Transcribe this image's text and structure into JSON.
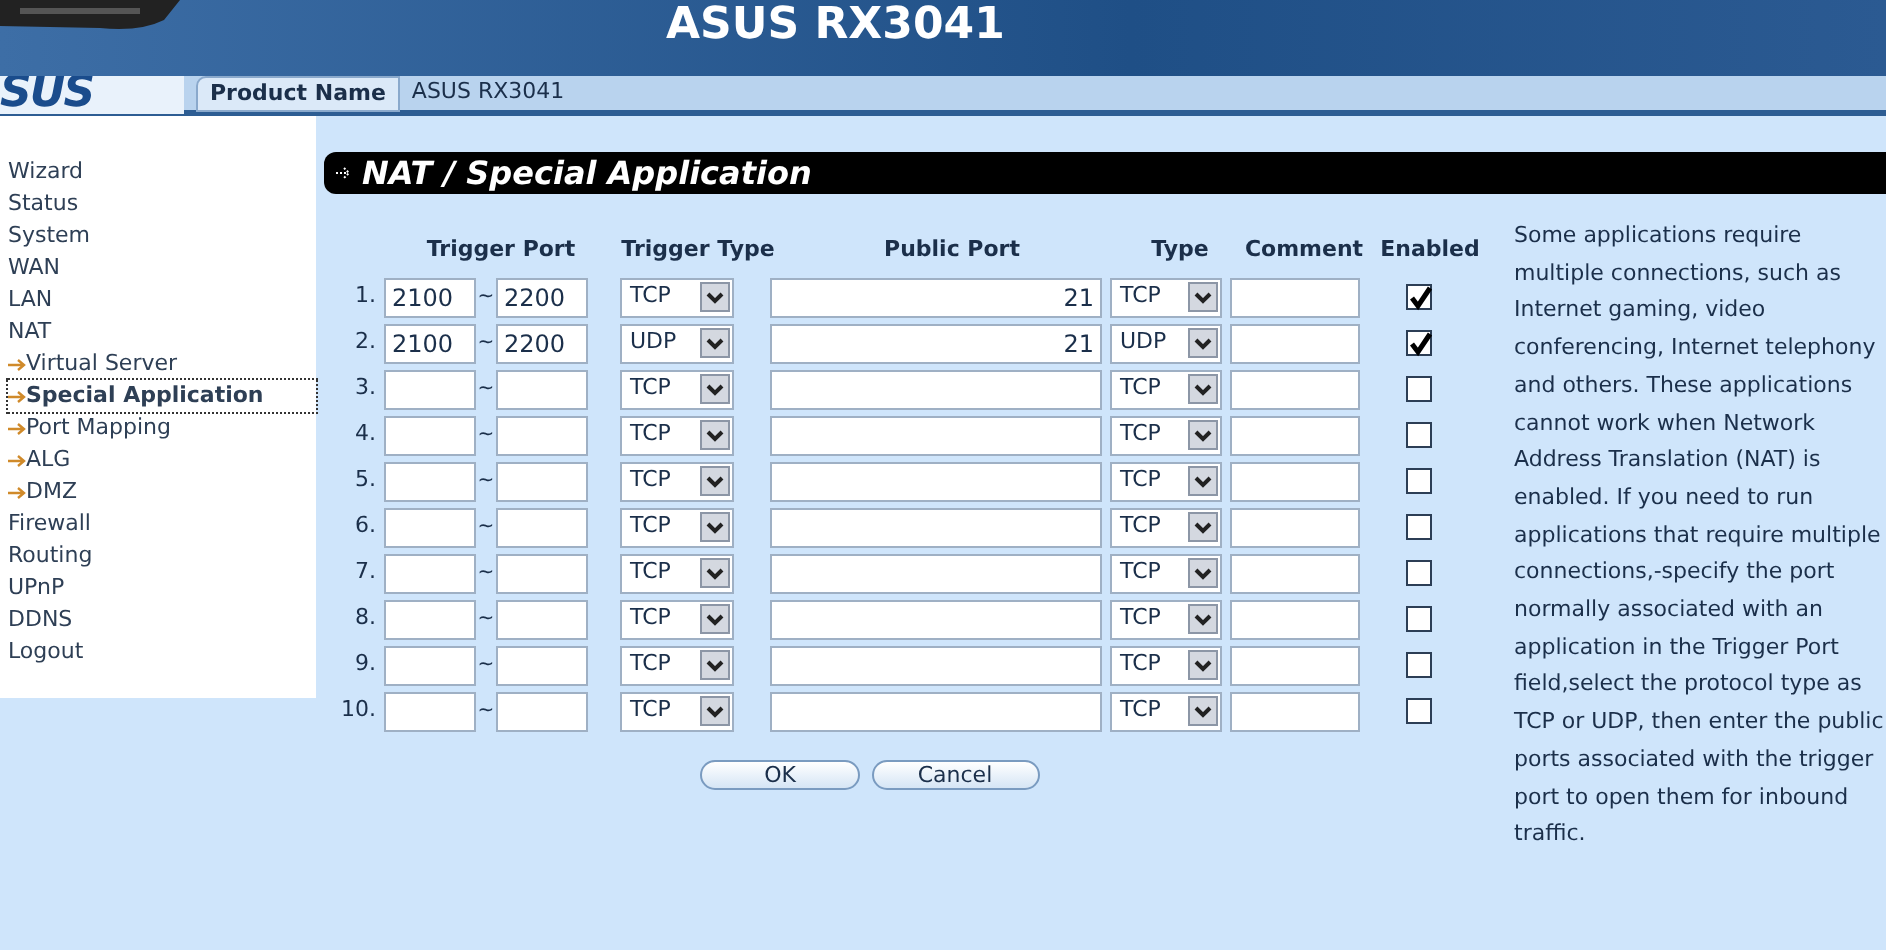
{
  "header": {
    "title": "ASUS RX3041",
    "logo": "SUS"
  },
  "product": {
    "label": "Product Name",
    "value": "ASUS RX3041"
  },
  "sidebar": {
    "items": [
      {
        "label": "Wizard",
        "selected": false
      },
      {
        "label": "Status",
        "selected": false
      },
      {
        "label": "System",
        "selected": false
      },
      {
        "label": "WAN",
        "selected": false
      },
      {
        "label": "LAN",
        "selected": false
      },
      {
        "label": "NAT",
        "selected": false,
        "children": [
          {
            "label": "Virtual Server",
            "selected": false
          },
          {
            "label": "Special Application",
            "selected": true
          },
          {
            "label": "Port Mapping",
            "selected": false
          },
          {
            "label": "ALG",
            "selected": false
          },
          {
            "label": "DMZ",
            "selected": false
          }
        ]
      },
      {
        "label": "Firewall",
        "selected": false
      },
      {
        "label": "Routing",
        "selected": false
      },
      {
        "label": "UPnP",
        "selected": false
      },
      {
        "label": "DDNS",
        "selected": false
      },
      {
        "label": "Logout",
        "selected": false
      }
    ]
  },
  "page_title": "NAT / Special Application",
  "table": {
    "columns": [
      "Trigger Port",
      "Trigger Type",
      "Public Port",
      "Type",
      "Comment",
      "Enabled"
    ],
    "separator": "~",
    "rows": [
      {
        "number": "1.",
        "trigger_from": "2100",
        "trigger_to": "2200",
        "trigger_type": "TCP",
        "public_port": "21",
        "type": "TCP",
        "comment": "",
        "enabled": true
      },
      {
        "number": "2.",
        "trigger_from": "2100",
        "trigger_to": "2200",
        "trigger_type": "UDP",
        "public_port": "21",
        "type": "UDP",
        "comment": "",
        "enabled": true
      },
      {
        "number": "3.",
        "trigger_type": "TCP",
        "type": "TCP",
        "enabled": false
      },
      {
        "number": "4.",
        "trigger_type": "TCP",
        "type": "TCP",
        "enabled": false
      },
      {
        "number": "5.",
        "trigger_type": "TCP",
        "type": "TCP",
        "enabled": false
      },
      {
        "number": "6.",
        "trigger_type": "TCP",
        "type": "TCP",
        "enabled": false
      },
      {
        "number": "7.",
        "trigger_type": "TCP",
        "type": "TCP",
        "enabled": false
      },
      {
        "number": "8.",
        "trigger_type": "TCP",
        "type": "TCP",
        "enabled": false
      },
      {
        "number": "9.",
        "trigger_type": "TCP",
        "type": "TCP",
        "enabled": false
      },
      {
        "number": "10.",
        "trigger_type": "TCP",
        "type": "TCP",
        "enabled": false
      }
    ]
  },
  "buttons": [
    "OK",
    "Cancel"
  ],
  "help_text": "Some applications require multiple connections, such as Internet gaming, video conferencing, Internet telephony and others. These applications cannot work when Network Address Translation (NAT) is enabled. If you need to run applications that require multiple connections,-specify the port normally associated with an application in the Trigger Port field,select the protocol type as TCP or UDP, then enter the public ports associated with the trigger port to open them for inbound traffic."
}
